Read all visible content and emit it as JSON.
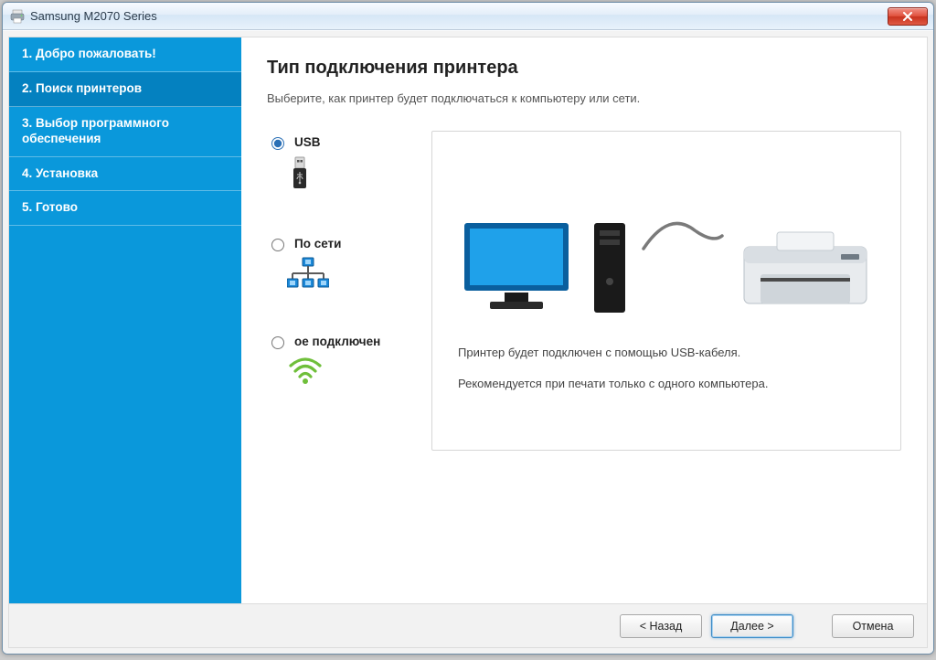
{
  "window": {
    "title": "Samsung M2070 Series"
  },
  "sidebar": {
    "steps": [
      "1. Добро пожаловать!",
      "2. Поиск принтеров",
      "3. Выбор программного обеспечения",
      "4. Установка",
      "5. Готово"
    ],
    "active_index": 1
  },
  "main": {
    "title": "Тип подключения принтера",
    "subtitle": "Выберите, как принтер будет подключаться к компьютеру или сети.",
    "options": {
      "usb": {
        "label": "USB",
        "selected": true
      },
      "network": {
        "label": "По сети",
        "selected": false
      },
      "wireless": {
        "label": "ое подключен",
        "selected": false
      }
    },
    "panel": {
      "line1": "Принтер будет подключен с помощью USB-кабеля.",
      "line2": "Рекомендуется при печати только с одного компьютера."
    }
  },
  "footer": {
    "back": "< Назад",
    "next": "Далее >",
    "cancel": "Отмена"
  },
  "icons": {
    "app": "printer-icon",
    "close": "close-icon"
  }
}
